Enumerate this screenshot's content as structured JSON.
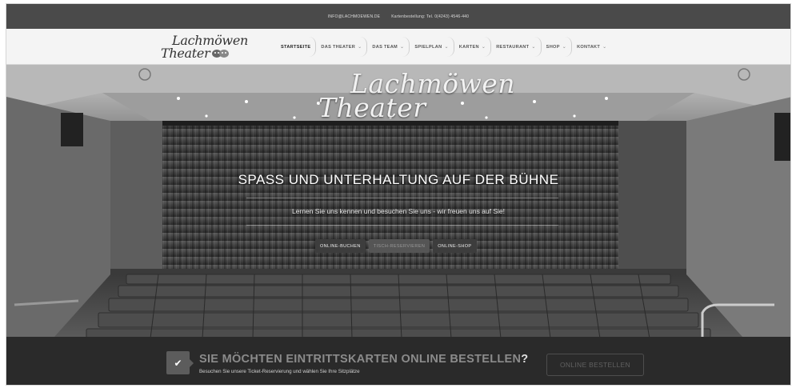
{
  "topbar": {
    "email": "INFO@LACHMOEWEN.DE",
    "phone": "Kartenbestellung: Tel. 0(4243) 4546-440"
  },
  "nav": {
    "logo_line1": "Lachmöwen",
    "logo_line2": "Theater",
    "items": [
      {
        "label": "STARTSEITE",
        "dropdown": false,
        "active": true
      },
      {
        "label": "DAS THEATER",
        "dropdown": true
      },
      {
        "label": "DAS TEAM",
        "dropdown": true
      },
      {
        "label": "SPIELPLAN",
        "dropdown": true
      },
      {
        "label": "KARTEN",
        "dropdown": true
      },
      {
        "label": "RESTAURANT",
        "dropdown": true
      },
      {
        "label": "SHOP",
        "dropdown": true
      },
      {
        "label": "KONTAKT",
        "dropdown": true
      }
    ],
    "chevron": "⌄"
  },
  "hero": {
    "logo_line1": "Lachmöwen",
    "logo_line2": "Theater",
    "headline": "SPASS UND UNTERHALTUNG AUF DER BÜHNE",
    "subline": "Lernen Sie uns kennen und besuchen Sie uns - wir freuen uns auf Sie!",
    "buttons": [
      "ONLINE-BUCHEN",
      "TISCH-RESERVIEREN",
      "ONLINE-SHOP"
    ]
  },
  "bottom": {
    "title": "SIE MÖCHTEN EINTRITTSKARTEN ONLINE BESTELLEN",
    "title_mark": "?",
    "subtitle": "Besuchen Sie unsere Ticket-Reservierung und wählen Sie Ihre Sitzplätze",
    "button": "ONLINE BESTELLEN",
    "check_glyph": "✔"
  }
}
